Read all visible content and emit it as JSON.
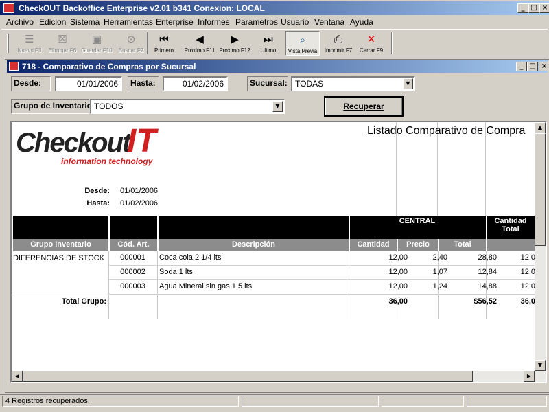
{
  "window": {
    "title": "CheckOUT Backoffice Enterprise v2.01 b341 Conexion: LOCAL"
  },
  "menu": [
    "Archivo",
    "Edicion",
    "Sistema",
    "Herramientas",
    "Enterprise",
    "Informes",
    "Parametros",
    "Usuario",
    "Ventana",
    "Ayuda"
  ],
  "toolbar": {
    "nuevo": "Nuevo F3",
    "eliminar": "Eliminar F6",
    "guardar": "Guardar F10",
    "buscar": "Buscar F2",
    "primero": "Primero",
    "proximo11": "Proximo F11",
    "proximo12": "Proximo F12",
    "ultimo": "Ultimo",
    "vista": "Vista Previa",
    "imprimir": "Imprimir F7",
    "cerrar": "Cerrar F9"
  },
  "child": {
    "title": "718 - Comparativo de Compras por Sucursal"
  },
  "filters": {
    "desde_label": "Desde:",
    "desde_value": "01/01/2006",
    "hasta_label": "Hasta:",
    "hasta_value": "01/02/2006",
    "sucursal_label": "Sucursal:",
    "sucursal_value": "TODAS",
    "grupo_label": "Grupo de Inventario:",
    "grupo_value": "TODOS",
    "recuperar_label": "Recuperar"
  },
  "report": {
    "title": "Listado Comparativo de Compra",
    "logo_main": "Checkout",
    "logo_it": "IT",
    "logo_sub": "information technology",
    "desde_label": "Desde:",
    "desde_value": "01/01/2006",
    "hasta_label": "Hasta:",
    "hasta_value": "01/02/2006",
    "central_label": "CENTRAL",
    "cantidad_total_label": "Cantidad Total",
    "columns": [
      "Grupo Inventario",
      "Cód. Art.",
      "Descripción",
      "Cantidad",
      "Precio",
      "Total"
    ],
    "group": "DIFERENCIAS DE STOCK",
    "rows": [
      {
        "cod": "000001",
        "desc": "Coca cola 2 1/4 lts",
        "cantidad": "12,00",
        "precio": "2,40",
        "total": "28,80",
        "cant_total": "12,0"
      },
      {
        "cod": "000002",
        "desc": "Soda 1 lts",
        "cantidad": "12,00",
        "precio": "1,07",
        "total": "12,84",
        "cant_total": "12,0"
      },
      {
        "cod": "000003",
        "desc": "Agua Mineral sin gas 1,5 lts",
        "cantidad": "12,00",
        "precio": "1,24",
        "total": "14,88",
        "cant_total": "12,0"
      }
    ],
    "total_label": "Total Grupo:",
    "total_cantidad": "36,00",
    "total_total": "$56,52",
    "total_cant_total": "36,0"
  },
  "status": {
    "text": "4 Registros recuperados."
  }
}
